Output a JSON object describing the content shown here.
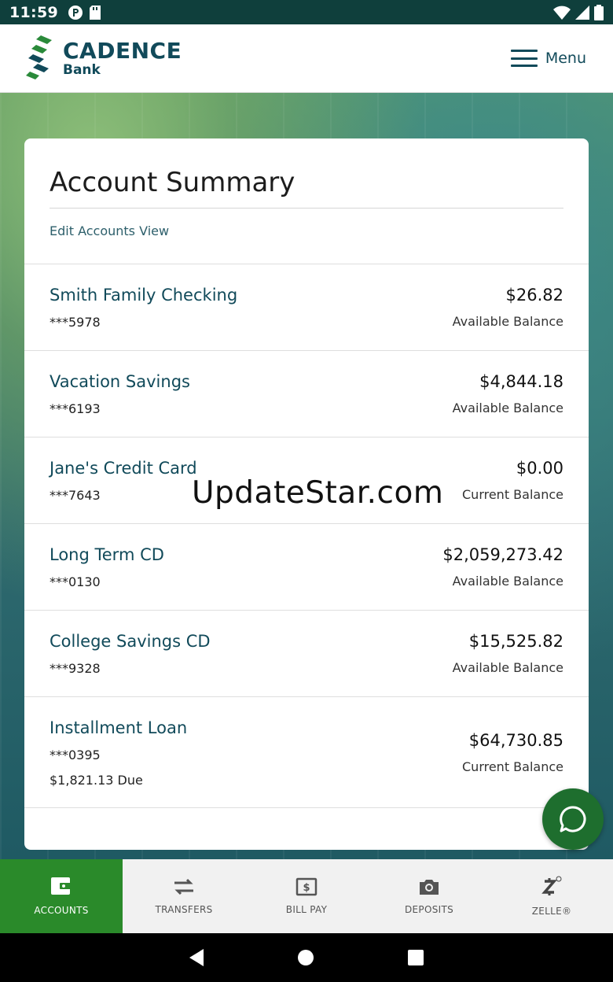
{
  "status_bar": {
    "time": "11:59"
  },
  "header": {
    "brand_name": "CADENCE",
    "brand_sub": "Bank",
    "menu_label": "Menu"
  },
  "card": {
    "title": "Account Summary",
    "edit_link": "Edit Accounts View",
    "accounts": [
      {
        "name": "Smith Family Checking",
        "number": "***5978",
        "amount": "$26.82",
        "label": "Available Balance"
      },
      {
        "name": "Vacation Savings",
        "number": "***6193",
        "amount": "$4,844.18",
        "label": "Available Balance"
      },
      {
        "name": "Jane's Credit Card",
        "number": "***7643",
        "amount": "$0.00",
        "label": "Current Balance"
      },
      {
        "name": "Long Term CD",
        "number": "***0130",
        "amount": "$2,059,273.42",
        "label": "Available Balance"
      },
      {
        "name": "College Savings CD",
        "number": "***9328",
        "amount": "$15,525.82",
        "label": "Available Balance"
      },
      {
        "name": "Installment Loan",
        "number": "***0395",
        "due": "$1,821.13 Due",
        "amount": "$64,730.85",
        "label": "Current Balance"
      }
    ]
  },
  "watermark": "UpdateStar.com",
  "tabs": [
    {
      "label": "ACCOUNTS",
      "icon": "wallet-icon",
      "active": true
    },
    {
      "label": "TRANSFERS",
      "icon": "transfer-arrows-icon"
    },
    {
      "label": "BILL PAY",
      "icon": "bill-pay-icon"
    },
    {
      "label": "DEPOSITS",
      "icon": "camera-icon"
    },
    {
      "label": "ZELLE®",
      "icon": "zelle-icon"
    }
  ],
  "colors": {
    "brand": "#114a5a",
    "active_tab": "#2a8a2a",
    "chat": "#1e6e2e",
    "status_bar": "#0f3f3c"
  }
}
